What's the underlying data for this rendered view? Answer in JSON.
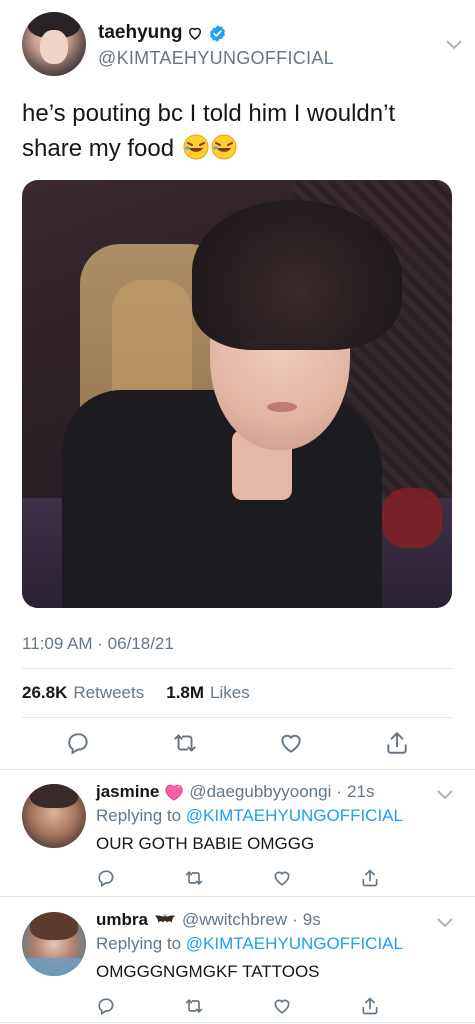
{
  "tweet": {
    "display_name": "taehyung",
    "handle": "@KIMTAEHYUNGOFFICIAL",
    "text": "he’s pouting bc I told him I wouldn’t share my food",
    "emoji": "rolling-on-floor-laughing-emoji",
    "timestamp": "11:09 AM · 06/18/21",
    "retweets_count": "26.8K",
    "retweets_label": "Retweets",
    "likes_count": "1.8M",
    "likes_label": "Likes"
  },
  "replies": [
    {
      "display_name": "jasmine",
      "name_emoji": "sparkling-heart-emoji",
      "handle": "@daegubbyyoongi",
      "separator": "·",
      "time": "21s",
      "replying_prefix": "Replying to",
      "replying_to": "@KIMTAEHYUNGOFFICIAL",
      "text": "OUR GOTH BABIE OMGGG"
    },
    {
      "display_name": "umbra",
      "name_emoji": "bat-emoji",
      "handle": "@wwitchbrew",
      "separator": "·",
      "time": "9s",
      "replying_prefix": "Replying to",
      "replying_to": "@KIMTAEHYUNGOFFICIAL",
      "text": "OMGGGNGMGKF TATTOOS"
    }
  ],
  "colors": {
    "link": "#1da1f2",
    "secondary_text": "#657786",
    "primary_text": "#14171a",
    "divider": "#e1e8ed",
    "verified": "#1da1f2"
  }
}
